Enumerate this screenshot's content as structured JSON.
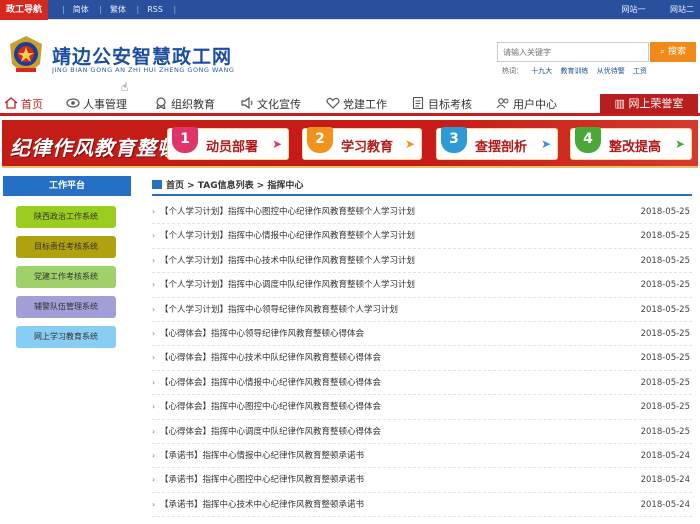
{
  "topbar": {
    "brand": "政工导航",
    "links": [
      "简体",
      "繁体",
      "RSS"
    ],
    "right_links": [
      "网站一",
      "网站二"
    ]
  },
  "header": {
    "title": "靖边公安智慧政工网",
    "subtitle": "JING BIAN GONG AN ZHI HUI ZHENG GONG WANG",
    "search": {
      "placeholder": "请输入关键字",
      "button": "搜索"
    },
    "hot": {
      "label": "热词：",
      "terms": [
        "十九大",
        "教育训练",
        "从优待警",
        "工资"
      ]
    }
  },
  "nav": {
    "items": [
      {
        "label": "首页",
        "icon": "home-icon"
      },
      {
        "label": "人事管理",
        "icon": "eye-icon"
      },
      {
        "label": "组织教育",
        "icon": "badge-icon"
      },
      {
        "label": "文化宣传",
        "icon": "speaker-icon"
      },
      {
        "label": "党建工作",
        "icon": "heart-icon"
      },
      {
        "label": "目标考核",
        "icon": "document-icon"
      },
      {
        "label": "用户中心",
        "icon": "users-icon"
      }
    ],
    "honor": "网上荣誉室"
  },
  "banner": {
    "title": "纪律作风教育整顿",
    "steps": [
      {
        "num": "1",
        "label": "动员部署",
        "color": "#e0356b"
      },
      {
        "num": "2",
        "label": "学习教育",
        "color": "#f0921c"
      },
      {
        "num": "3",
        "label": "查摆剖析",
        "color": "#2d9ad6"
      },
      {
        "num": "4",
        "label": "整改提高",
        "color": "#4aa83a"
      }
    ]
  },
  "sidebar": {
    "title": "工作平台",
    "items": [
      {
        "label": "陕西政治工作系统",
        "color": "#9acd1d"
      },
      {
        "label": "目标责任考核系统",
        "color": "#b0a10f"
      },
      {
        "label": "党建工作考核系统",
        "color": "#9fd06a"
      },
      {
        "label": "辅警队伍管理系统",
        "color": "#a29fd8"
      },
      {
        "label": "网上学习教育系统",
        "color": "#88cdf3"
      }
    ]
  },
  "breadcrumb": "首页 > TAG信息列表 > 指挥中心",
  "articles": [
    {
      "title": "【个人学习计划】指挥中心图控中心纪律作风教育整顿个人学习计划",
      "date": "2018-05-25"
    },
    {
      "title": "【个人学习计划】指挥中心情报中心纪律作风教育整顿个人学习计划",
      "date": "2018-05-25"
    },
    {
      "title": "【个人学习计划】指挥中心技术中队纪律作风教育整顿个人学习计划",
      "date": "2018-05-25"
    },
    {
      "title": "【个人学习计划】指挥中心调度中队纪律作风教育整顿个人学习计划",
      "date": "2018-05-25"
    },
    {
      "title": "【个人学习计划】指挥中心领导纪律作风教育整顿个人学习计划",
      "date": "2018-05-25"
    },
    {
      "title": "【心得体会】指挥中心领导纪律作风教育整顿心得体会",
      "date": "2018-05-25"
    },
    {
      "title": "【心得体会】指挥中心技术中队纪律作风教育整顿心得体会",
      "date": "2018-05-25"
    },
    {
      "title": "【心得体会】指挥中心情报中心纪律作风教育整顿心得体会",
      "date": "2018-05-25"
    },
    {
      "title": "【心得体会】指挥中心图控中心纪律作风教育整顿心得体会",
      "date": "2018-05-25"
    },
    {
      "title": "【心得体会】指挥中心调度中队纪律作风教育整顿心得体会",
      "date": "2018-05-25"
    },
    {
      "title": "【承诺书】指挥中心情报中心纪律作风教育整顿承诺书",
      "date": "2018-05-24"
    },
    {
      "title": "【承诺书】指挥中心图控中心纪律作风教育整顿承诺书",
      "date": "2018-05-24"
    },
    {
      "title": "【承诺书】指挥中心技术中心纪律作风教育整顿承诺书",
      "date": "2018-05-24"
    }
  ]
}
